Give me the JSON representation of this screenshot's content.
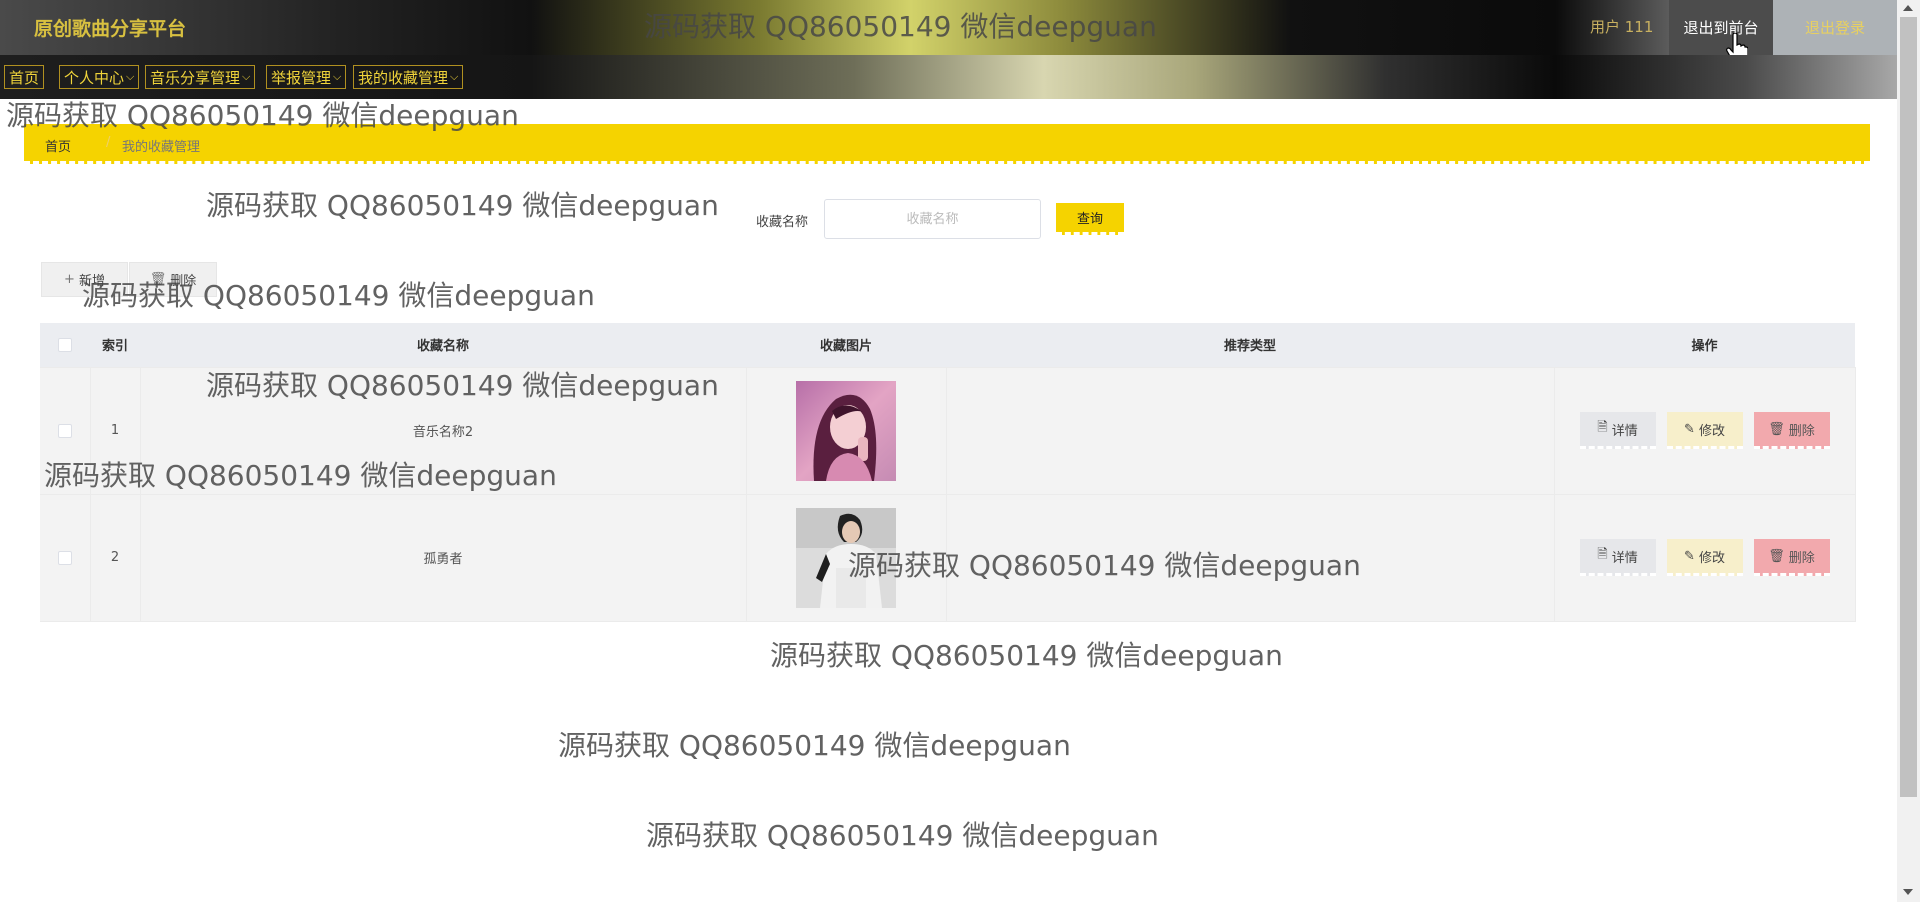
{
  "header": {
    "brand": "原创歌曲分享平台",
    "user_label": "用户 111",
    "front_button": "退出到前台",
    "logout_button": "退出登录"
  },
  "nav": {
    "items": [
      {
        "label": "首页",
        "has_dropdown": false
      },
      {
        "label": "个人中心",
        "has_dropdown": true
      },
      {
        "label": "音乐分享管理",
        "has_dropdown": true
      },
      {
        "label": "举报管理",
        "has_dropdown": true
      },
      {
        "label": "我的收藏管理",
        "has_dropdown": true
      }
    ]
  },
  "breadcrumb": {
    "home": "首页",
    "separator": "/",
    "current": "我的收藏管理"
  },
  "search": {
    "label": "收藏名称",
    "placeholder": "收藏名称",
    "value": "",
    "button": "查询"
  },
  "actions": {
    "add": "新增",
    "delete": "删除"
  },
  "table": {
    "columns": [
      "索引",
      "收藏名称",
      "收藏图片",
      "推荐类型",
      "操作"
    ],
    "rows": [
      {
        "index": "1",
        "name": "音乐名称2",
        "type": "",
        "image": "pink-portrait"
      },
      {
        "index": "2",
        "name": "孤勇者",
        "type": "",
        "image": "bw-portrait"
      }
    ],
    "row_actions": {
      "detail": "详情",
      "edit": "修改",
      "delete": "删除"
    }
  },
  "watermark": "源码获取 QQ86050149 微信deepguan",
  "colors": {
    "accent": "#f5d300",
    "nav_text": "#f0d43a",
    "delete_button": "#f2a9ad",
    "edit_button": "#f7efcb"
  }
}
